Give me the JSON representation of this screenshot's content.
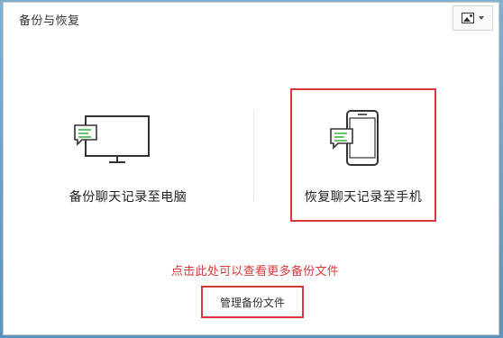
{
  "window": {
    "title": "备份与恢复"
  },
  "topright": {
    "icon": "picture-icon",
    "dropdown_icon": "chevron-down-icon"
  },
  "options": [
    {
      "label": "备份聊天记录至电脑",
      "icon": "monitor-chat-icon"
    },
    {
      "label": "恢复聊天记录至手机",
      "icon": "phone-chat-icon"
    }
  ],
  "hint_text": "点击此处可以查看更多备份文件",
  "manage_button_label": "管理备份文件",
  "colors": {
    "highlight": "#d9393b",
    "chat_bubble_accent": "#3fb34f",
    "icon_stroke": "#333333"
  }
}
